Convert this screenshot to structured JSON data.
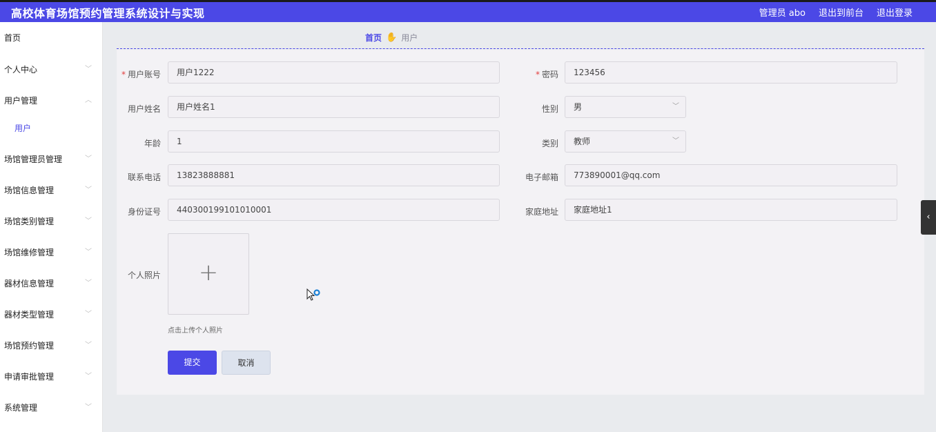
{
  "header": {
    "title": "高校体育场馆预约管理系统设计与实现",
    "admin_label": "管理员 abo",
    "to_front": "退出到前台",
    "logout": "退出登录"
  },
  "sidebar": {
    "items": [
      {
        "label": "首页"
      },
      {
        "label": "个人中心"
      },
      {
        "label": "用户管理"
      },
      {
        "label": "用户"
      },
      {
        "label": "场馆管理员管理"
      },
      {
        "label": "场馆信息管理"
      },
      {
        "label": "场馆类别管理"
      },
      {
        "label": "场馆维修管理"
      },
      {
        "label": "器材信息管理"
      },
      {
        "label": "器材类型管理"
      },
      {
        "label": "场馆预约管理"
      },
      {
        "label": "申请审批管理"
      },
      {
        "label": "系统管理"
      }
    ]
  },
  "breadcrumb": {
    "home": "首页",
    "current": "用户"
  },
  "form": {
    "account_label": "用户账号",
    "account_value": "用户1222",
    "password_label": "密码",
    "password_value": "123456",
    "name_label": "用户姓名",
    "name_value": "用户姓名1",
    "gender_label": "性别",
    "gender_value": "男",
    "age_label": "年龄",
    "age_value": "1",
    "category_label": "类别",
    "category_value": "教师",
    "phone_label": "联系电话",
    "phone_value": "13823888881",
    "email_label": "电子邮箱",
    "email_value": "773890001@qq.com",
    "idcard_label": "身份证号",
    "idcard_value": "440300199101010001",
    "address_label": "家庭地址",
    "address_value": "家庭地址1",
    "photo_label": "个人照片",
    "photo_hint": "点击上传个人照片",
    "submit": "提交",
    "cancel": "取消"
  },
  "colors": {
    "accent": "#4b48e6",
    "required": "#e23c3c"
  }
}
